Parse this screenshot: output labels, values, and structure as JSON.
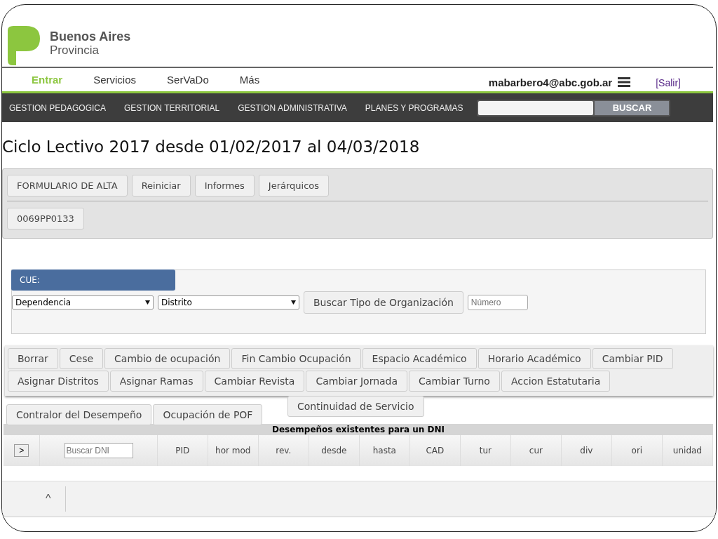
{
  "logo": {
    "line1": "Buenos Aires",
    "line2": "Provincia"
  },
  "top_nav": [
    {
      "label": "Entrar",
      "selected": true
    },
    {
      "label": "Servicios",
      "selected": false
    },
    {
      "label": "SerVaDo",
      "selected": false
    },
    {
      "label": "Más",
      "selected": false
    }
  ],
  "user": {
    "email": "mabarbero4@abc.gob.ar",
    "logout": "[Salir]"
  },
  "main_menu": [
    "GESTION PEDAGOGICA",
    "GESTION TERRITORIAL",
    "GESTION ADMINISTRATIVA",
    "PLANES Y PROGRAMAS"
  ],
  "search": {
    "button": "BUSCAR"
  },
  "page_title": "Ciclo Lectivo 2017 desde 01/02/2017 al 04/03/2018",
  "panel_buttons": [
    "FORMULARIO DE ALTA",
    "Reiniciar",
    "Informes",
    "Jerárquicos"
  ],
  "code_button": "0069PP0133",
  "cue": {
    "label": "CUE:",
    "dependencia": "Dependencia",
    "distrito": "Distrito",
    "search_button": "Buscar Tipo de Organización",
    "number_placeholder": "Número"
  },
  "action_rows": [
    [
      "Borrar",
      "Cese",
      "Cambio de ocupación",
      "Fin Cambio Ocupación",
      "Espacio Académico",
      "Horario Académico",
      "Cambiar PID"
    ],
    [
      "Asignar Distritos",
      "Asignar Ramas",
      "Cambiar Revista",
      "Cambiar Jornada",
      "Cambiar Turno",
      "Accion Estatutaria"
    ]
  ],
  "partial_row": [
    "Continuidad de Servicio"
  ],
  "bottom_row": [
    "Contralor del Desempeño",
    "Ocupación de POF"
  ],
  "table": {
    "title": "Desempeños existentes para un DNI",
    "expand": ">",
    "dni_placeholder": "Buscar DNI",
    "columns": [
      "PID",
      "hor mod",
      "rev.",
      "desde",
      "hasta",
      "CAD",
      "tur",
      "cur",
      "div",
      "ori",
      "unidad"
    ]
  },
  "footer": {
    "toggle": "^"
  }
}
